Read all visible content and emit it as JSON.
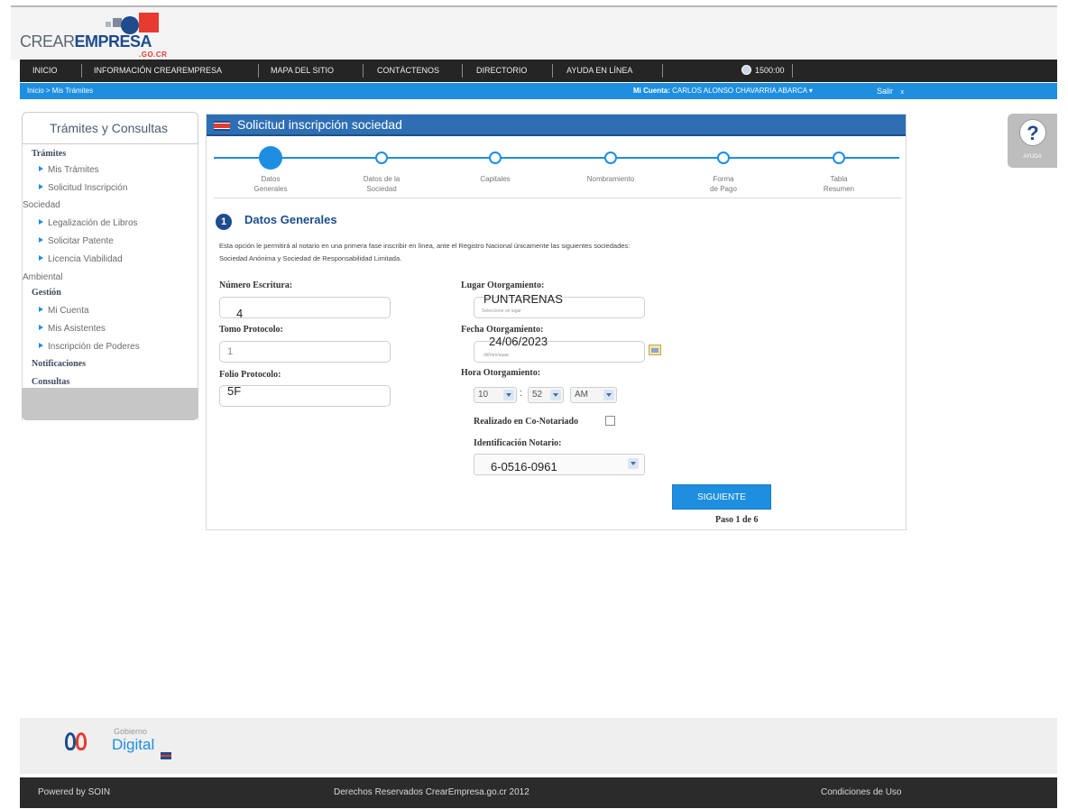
{
  "logo": {
    "brand_light": "CREAR",
    "brand_bold": "EMPRESA",
    "domain": ".GO.CR"
  },
  "nav": {
    "items": [
      "INICIO",
      "INFORMACIÓN CREAREMPRESA",
      "MAPA DEL SITIO",
      "CONTÁCTENOS",
      "DIRECTORIO",
      "AYUDA EN LÍNEA"
    ],
    "timer": "1500:00"
  },
  "breadcrumb": "Inicio > Mis Trámites",
  "account": {
    "label": "Mi Cuenta:",
    "name": "CARLOS ALONSO CHAVARRIA ABARCA",
    "caret": "▾",
    "logout": "Salir",
    "logout_mark": "x"
  },
  "sidebar": {
    "title": "Trámites y Consultas",
    "sections": {
      "tramites": "Trámites",
      "sociedad": "Sociedad",
      "ambiental": "Ambiental",
      "gestion": "Gestión",
      "notificaciones": "Notificaciones",
      "consultas": "Consultas"
    },
    "links": {
      "mis_tramites": "Mis Trámites",
      "solicitud": "Solicitud Inscripción",
      "legalizacion": "Legalización de Libros",
      "patente": "Solicitar Patente",
      "licencia": "Licencia Viabilidad",
      "mi_cuenta": "Mi Cuenta",
      "asistentes": "Mis Asistentes",
      "poderes": "Inscripción de Poderes"
    }
  },
  "panel": {
    "title": "Solicitud inscripción sociedad",
    "steps": [
      {
        "line1": "Datos",
        "line2": "Generales",
        "active": true
      },
      {
        "line1": "Datos de la",
        "line2": "Sociedad",
        "active": false
      },
      {
        "line1": "Capitales",
        "line2": "",
        "active": false
      },
      {
        "line1": "Nombramiento",
        "line2": "",
        "active": false
      },
      {
        "line1": "Forma",
        "line2": "de Pago",
        "active": false
      },
      {
        "line1": "Tabla",
        "line2": "Resumen",
        "active": false
      }
    ],
    "section_number": "1",
    "section_title": "Datos Generales",
    "description_line1": "Esta opción le permitirá al notario en una primera fase inscribir en línea, ante el Registro Nacional únicamente las siguientes sociedades:",
    "description_line2": "Sociedad Anónima y Sociedad de Responsabilidad Limitada."
  },
  "form": {
    "numero_escritura": {
      "label": "Número Escritura:",
      "value": "4"
    },
    "tomo_protocolo": {
      "label": "Tomo Protocolo:",
      "value": "1"
    },
    "folio_protocolo": {
      "label": "Folio Protocolo:",
      "value": "5F"
    },
    "lugar_otorgamiento": {
      "label": "Lugar Otorgamiento:",
      "value": "PUNTARENAS",
      "hint": "Seleccione un lugar"
    },
    "fecha_otorgamiento": {
      "label": "Fecha Otorgamiento:",
      "value": "24/06/2023",
      "hint": "dd/mm/aaaa"
    },
    "hora_otorgamiento": {
      "label": "Hora Otorgamiento:",
      "hour": "10",
      "minute": "52",
      "ampm": "AM",
      "colon": ":"
    },
    "conotariado": {
      "label": "Realizado en Co-Notariado"
    },
    "identificacion_notario": {
      "label": "Identificación Notario:",
      "value": "6-0516-0961"
    },
    "next_button": "SIGUIENTE",
    "step_count": "Paso 1 de 6"
  },
  "help": {
    "symbol": "?",
    "label": "AYUDA"
  },
  "footer": {
    "gd_small": "Gobierno",
    "gd_big": "Digital",
    "powered": "Powered by SOIN",
    "rights": "Derechos Reservados CrearEmpresa.go.cr 2012",
    "terms": "Condiciones de Uso"
  },
  "colors": {
    "accent": "#1e8fe0",
    "brand_blue": "#1e4c8c",
    "brand_red": "#e63b2e",
    "nav_bg": "#252525"
  }
}
